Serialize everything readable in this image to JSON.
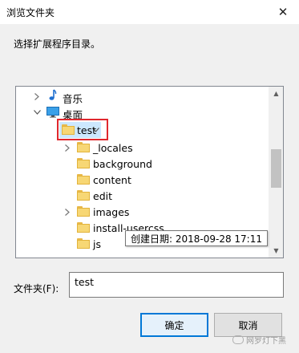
{
  "window": {
    "title": "浏览文件夹"
  },
  "prompt": "选择扩展程序目录。",
  "tree": {
    "items": [
      {
        "label": "音乐",
        "icon": "music-note-icon",
        "expander": "collapsed"
      },
      {
        "label": "桌面",
        "icon": "desktop-icon",
        "expander": "expanded"
      },
      {
        "label": "test",
        "icon": "folder-icon",
        "expander": "expanded",
        "selected": true
      },
      {
        "label": "_locales",
        "icon": "folder-icon",
        "expander": "collapsed"
      },
      {
        "label": "background",
        "icon": "folder-icon",
        "expander": "none"
      },
      {
        "label": "content",
        "icon": "folder-icon",
        "expander": "none"
      },
      {
        "label": "edit",
        "icon": "folder-icon",
        "expander": "none"
      },
      {
        "label": "images",
        "icon": "folder-icon",
        "expander": "collapsed"
      },
      {
        "label": "install-usercss",
        "icon": "folder-icon",
        "expander": "none"
      },
      {
        "label": "js",
        "icon": "folder-icon",
        "expander": "none"
      }
    ]
  },
  "tooltip": "创建日期: 2018-09-28 17:11",
  "folder_field": {
    "label": "文件夹(F):",
    "value": "test"
  },
  "buttons": {
    "ok": "确定",
    "cancel": "取消"
  },
  "watermark": "网罗灯下黑",
  "colors": {
    "highlight_outline": "#e0282e",
    "accent": "#0078d7",
    "folder": "#f7d775"
  }
}
